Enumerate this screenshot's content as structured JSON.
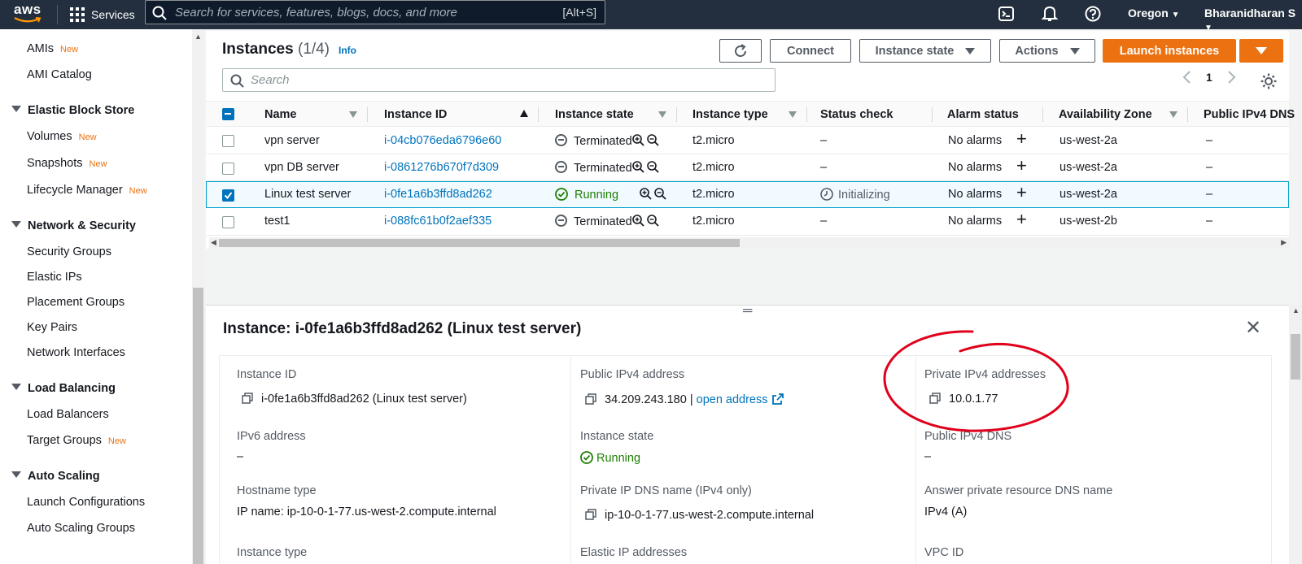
{
  "topnav": {
    "logo": "aws",
    "services_label": "Services",
    "search_placeholder": "Search for services, features, blogs, docs, and more",
    "search_shortcut": "[Alt+S]",
    "region": "Oregon",
    "user": "Bharanidharan S"
  },
  "sidebar": {
    "items_top": [
      {
        "label": "AMIs",
        "badge": "New"
      },
      {
        "label": "AMI Catalog",
        "badge": ""
      }
    ],
    "ebs_heading": "Elastic Block Store",
    "ebs_items": [
      {
        "label": "Volumes",
        "badge": "New"
      },
      {
        "label": "Snapshots",
        "badge": "New"
      },
      {
        "label": "Lifecycle Manager",
        "badge": "New"
      }
    ],
    "netsec_heading": "Network & Security",
    "netsec_items": [
      "Security Groups",
      "Elastic IPs",
      "Placement Groups",
      "Key Pairs",
      "Network Interfaces"
    ],
    "lb_heading": "Load Balancing",
    "lb_items": [
      {
        "label": "Load Balancers",
        "badge": ""
      },
      {
        "label": "Target Groups",
        "badge": "New"
      }
    ],
    "as_heading": "Auto Scaling",
    "as_items": [
      "Launch Configurations",
      "Auto Scaling Groups"
    ]
  },
  "instances": {
    "title": "Instances",
    "count": "(1/4)",
    "info": "Info",
    "buttons": {
      "connect": "Connect",
      "instance_state": "Instance state",
      "actions": "Actions",
      "launch": "Launch instances"
    },
    "search_placeholder": "Search",
    "page": "1",
    "columns": [
      "Name",
      "Instance ID",
      "Instance state",
      "Instance type",
      "Status check",
      "Alarm status",
      "Availability Zone",
      "Public IPv4 DNS"
    ],
    "rows": [
      {
        "name": "vpn server",
        "id": "i-04cb076eda6796e60",
        "state": "Terminated",
        "type": "t2.micro",
        "status": "–",
        "alarm": "No alarms",
        "az": "us-west-2a",
        "dns": "–"
      },
      {
        "name": "vpn DB server",
        "id": "i-0861276b670f7d309",
        "state": "Terminated",
        "type": "t2.micro",
        "status": "–",
        "alarm": "No alarms",
        "az": "us-west-2a",
        "dns": "–"
      },
      {
        "name": "Linux test server",
        "id": "i-0fe1a6b3ffd8ad262",
        "state": "Running",
        "type": "t2.micro",
        "status": "Initializing",
        "alarm": "No alarms",
        "az": "us-west-2a",
        "dns": "–"
      },
      {
        "name": "test1",
        "id": "i-088fc61b0f2aef335",
        "state": "Terminated",
        "type": "t2.micro",
        "status": "–",
        "alarm": "No alarms",
        "az": "us-west-2b",
        "dns": "–"
      }
    ]
  },
  "detail": {
    "title": "Instance: i-0fe1a6b3ffd8ad262 (Linux test server)",
    "col1": {
      "instance_id_label": "Instance ID",
      "instance_id_value": "i-0fe1a6b3ffd8ad262 (Linux test server)",
      "ipv6_label": "IPv6 address",
      "ipv6_value": "–",
      "hostname_label": "Hostname type",
      "hostname_value": "IP name: ip-10-0-1-77.us-west-2.compute.internal",
      "type_label": "Instance type"
    },
    "col2": {
      "public_ip_label": "Public IPv4 address",
      "public_ip_value": "34.209.243.180 |",
      "open_address": "open address",
      "state_label": "Instance state",
      "state_value": "Running",
      "private_dns_label": "Private IP DNS name (IPv4 only)",
      "private_dns_value": "ip-10-0-1-77.us-west-2.compute.internal",
      "elastic_label": "Elastic IP addresses"
    },
    "col3": {
      "private_ip_label": "Private IPv4 addresses",
      "private_ip_value": "10.0.1.77",
      "public_dns_label": "Public IPv4 DNS",
      "public_dns_value": "–",
      "answer_label": "Answer private resource DNS name",
      "answer_value": "IPv4 (A)",
      "vpc_label": "VPC ID"
    }
  },
  "colors": {
    "nav_bg": "#232f3e",
    "accent_orange": "#ec7211",
    "link_blue": "#0073bb",
    "running_green": "#1d8102",
    "annotation_red": "#e0001b"
  }
}
